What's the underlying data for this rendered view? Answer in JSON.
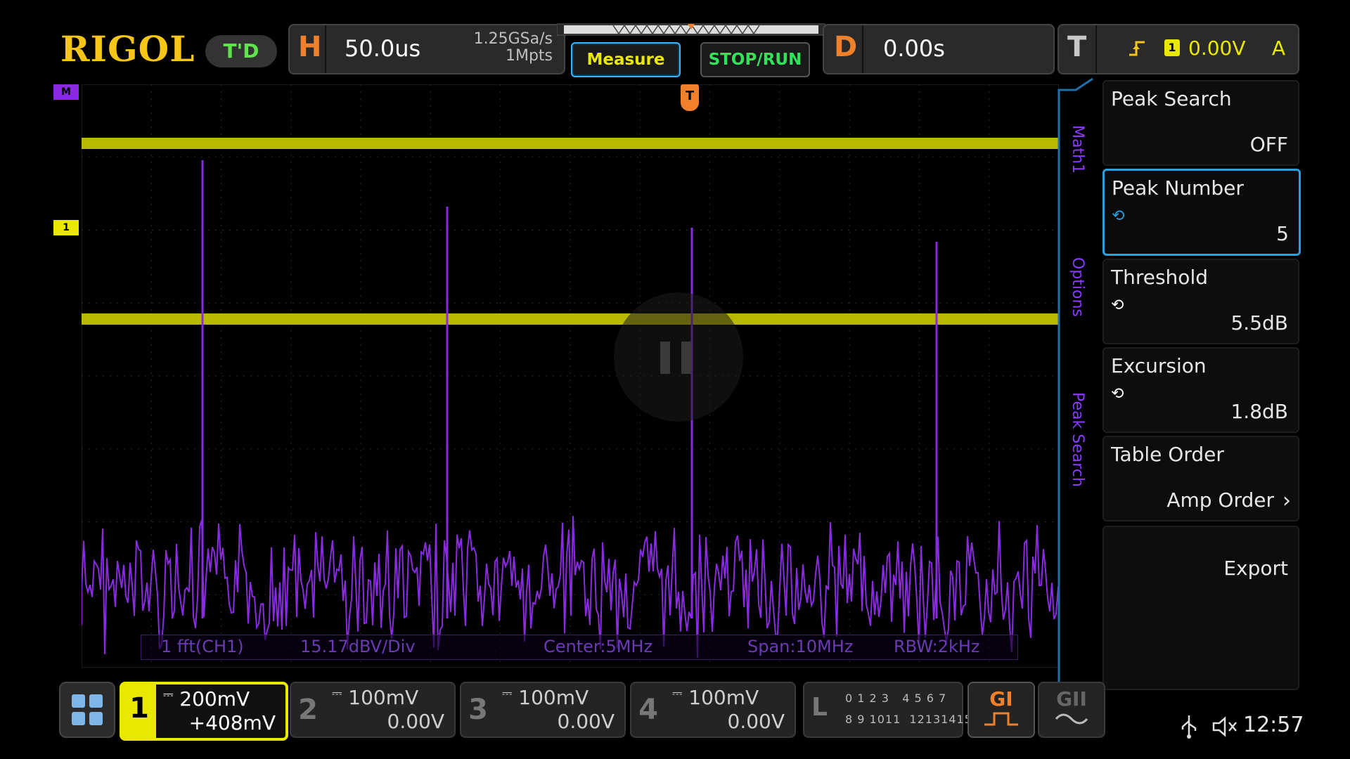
{
  "brand": "RIGOL",
  "mode_badge": "T'D",
  "horizontal": {
    "letter": "H",
    "timebase": "50.0us",
    "sample_rate": "1.25GSa/s",
    "memory_depth": "1Mpts"
  },
  "buttons": {
    "measure": "Measure",
    "stop_run": "STOP/RUN"
  },
  "delay": {
    "letter": "D",
    "value": "0.00s"
  },
  "trigger": {
    "letter": "T",
    "source": "1",
    "level": "0.00V",
    "mode": "A"
  },
  "channel_markers": {
    "math": "M",
    "ch1": "1",
    "trigger_t": "T"
  },
  "fft_info": {
    "source": "1 fft(CH1)",
    "scale": "15.17dBV/Div",
    "center": "Center:5MHz",
    "span": "Span:10MHz",
    "rbw": "RBW:2kHz"
  },
  "menu_tabs": [
    "Math1",
    "Options",
    "Peak Search"
  ],
  "menu": [
    {
      "title": "Peak Search",
      "value": "OFF"
    },
    {
      "title": "Peak Number",
      "value": "5"
    },
    {
      "title": "Threshold",
      "value": "5.5dB"
    },
    {
      "title": "Excursion",
      "value": "1.8dB"
    },
    {
      "title": "Table Order",
      "value": "Amp Order"
    },
    {
      "title": "Export",
      "value": ""
    }
  ],
  "channels": [
    {
      "num": "1",
      "scale": "200mV",
      "offset": "+408mV"
    },
    {
      "num": "2",
      "scale": "100mV",
      "offset": "0.00V"
    },
    {
      "num": "3",
      "scale": "100mV",
      "offset": "0.00V"
    },
    {
      "num": "4",
      "scale": "100mV",
      "offset": "0.00V"
    }
  ],
  "logic": {
    "letter": "L",
    "bits_row1": "0 1 2 3   4 5 6 7",
    "bits_row2": "8 9 1011  12131415"
  },
  "gen": {
    "g1": "GI",
    "g2": "GII"
  },
  "clock": "12:57",
  "colors": {
    "ch1": "#e8e800",
    "math": "#8a2be2",
    "accent": "#f0812a",
    "menu_border": "#27a0e0"
  }
}
